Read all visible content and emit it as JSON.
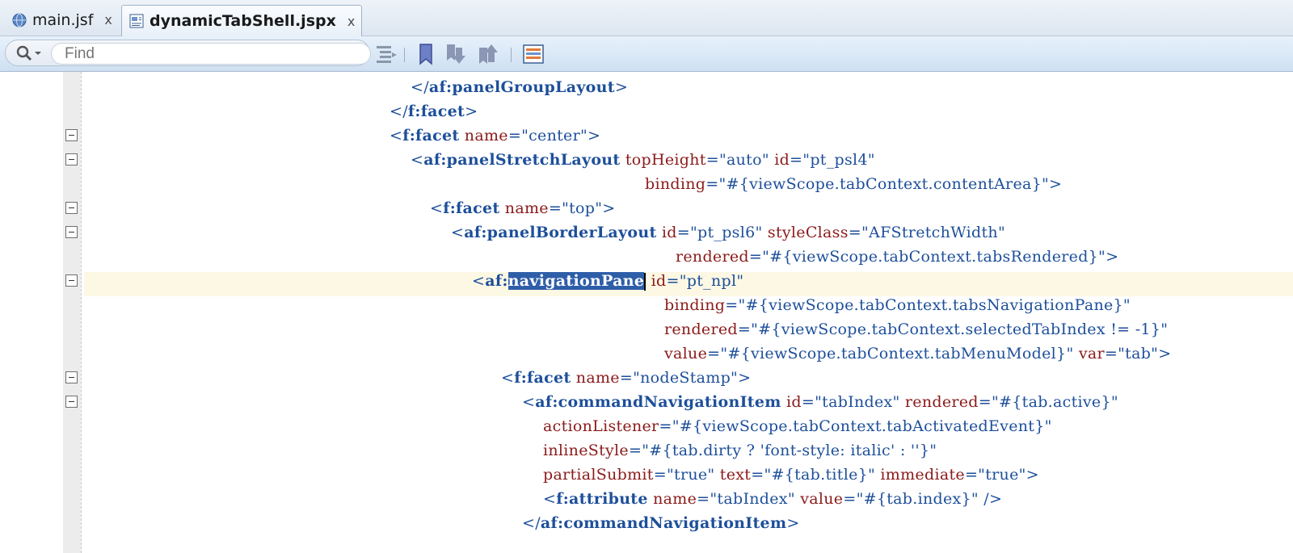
{
  "tabs": [
    {
      "label": "main.jsf",
      "icon": "globe-icon",
      "active": false,
      "close": "x"
    },
    {
      "label": "dynamicTabShell.jspx",
      "icon": "jsp-page-icon",
      "active": true,
      "close": "x"
    }
  ],
  "toolbar": {
    "search": {
      "placeholder": "Find",
      "value": ""
    },
    "buttons": [
      "format-icon",
      "bookmark-icon",
      "previous-bookmark-icon",
      "next-bookmark-icon",
      "structure-view-icon"
    ]
  },
  "code": [
    "</af:panelGroupLayout>",
    "</f:facet>",
    "<f:facet name=\"center\">",
    "<af:panelStretchLayout topHeight=\"auto\" id=\"pt_psl4\"",
    "binding=\"#{viewScope.tabContext.contentArea}\">",
    "<f:facet name=\"top\">",
    "<af:panelBorderLayout id=\"pt_psl6\" styleClass=\"AFStretchWidth\"",
    "rendered=\"#{viewScope.tabContext.tabsRendered}\">",
    "<af:navigationPane id=\"pt_npl\"",
    "binding=\"#{viewScope.tabContext.tabsNavigationPane}\"",
    "rendered=\"#{viewScope.tabContext.selectedTabIndex != -1}\"",
    "value=\"#{viewScope.tabContext.tabMenuModel}\" var=\"tab\">",
    "<f:facet name=\"nodeStamp\">",
    "<af:commandNavigationItem id=\"tabIndex\" rendered=\"#{tab.active}\"",
    "actionListener=\"#{viewScope.tabContext.tabActivatedEvent}\"",
    "inlineStyle=\"#{tab.dirty ? 'font-style: italic' : ''}\"",
    "partialSubmit=\"true\" text=\"#{tab.title}\" immediate=\"true\">",
    "<f:attribute name=\"tabIndex\" value=\"#{tab.index}\" />",
    "</af:commandNavigationItem>"
  ],
  "selected_text": "navigationPane",
  "colors": {
    "tag": "#1d4f9a",
    "attribute": "#8b1a1a",
    "value": "#1d4f9a",
    "selection": "#2f5ea8",
    "current_line": "#fdf8e4"
  }
}
